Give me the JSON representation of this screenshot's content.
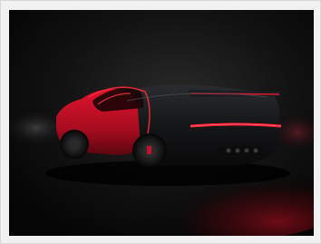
{
  "image": {
    "subject": "",
    "colors": {
      "body_red": "#c8102e",
      "body_black": "#111214",
      "background": "#0a0a0a",
      "frame": "#f1f1f1"
    }
  }
}
